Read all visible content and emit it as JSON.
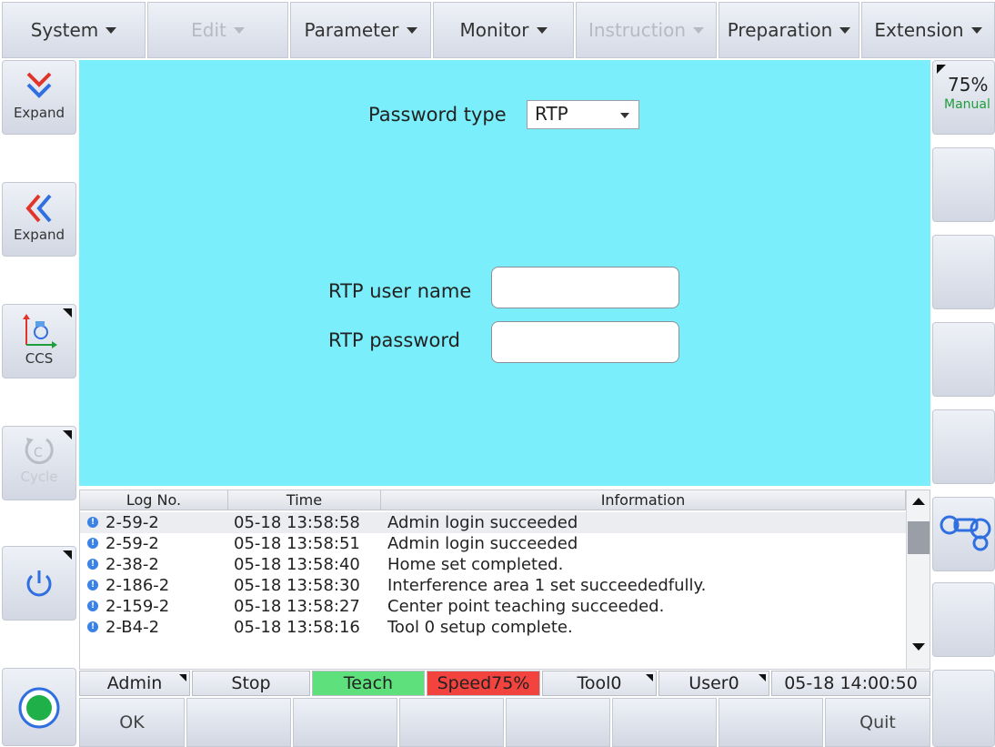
{
  "menu": [
    {
      "label": "System",
      "enabled": true
    },
    {
      "label": "Edit",
      "enabled": false
    },
    {
      "label": "Parameter",
      "enabled": true
    },
    {
      "label": "Monitor",
      "enabled": true
    },
    {
      "label": "Instruction",
      "enabled": false
    },
    {
      "label": "Preparation",
      "enabled": true
    },
    {
      "label": "Extension",
      "enabled": true
    }
  ],
  "left_buttons": {
    "expand_down": "Expand",
    "expand_left": "Expand",
    "ccs": "CCS",
    "cycle": "Cycle"
  },
  "speed_panel": {
    "speed": "75%",
    "mode": "Manual"
  },
  "form": {
    "password_type_label": "Password type",
    "password_type_value": "RTP",
    "user_label": "RTP user name",
    "user_value": "",
    "password_label": "RTP password",
    "password_value": ""
  },
  "log": {
    "headers": [
      "Log No.",
      "Time",
      "Information"
    ],
    "rows": [
      {
        "no": "2-59-2",
        "time": "05-18 13:58:58",
        "info": "Admin  login succeeded"
      },
      {
        "no": "2-59-2",
        "time": "05-18 13:58:51",
        "info": "Admin  login succeeded"
      },
      {
        "no": "2-38-2",
        "time": "05-18 13:58:40",
        "info": "Home set completed."
      },
      {
        "no": "2-186-2",
        "time": "05-18 13:58:30",
        "info": "Interference area 1 set succeededfully."
      },
      {
        "no": "2-159-2",
        "time": "05-18 13:58:27",
        "info": "Center point teaching succeeded."
      },
      {
        "no": "2-B4-2",
        "time": "05-18 13:58:16",
        "info": "Tool 0 setup complete."
      }
    ]
  },
  "status_bar": {
    "user": "Admin",
    "run_state": "Stop",
    "mode": "Teach",
    "speed": "Speed75%",
    "tool": "Tool0",
    "coord": "User0",
    "datetime": "05-18 14:00:50"
  },
  "bottom_buttons": {
    "ok": "OK",
    "quit": "Quit"
  },
  "colors": {
    "panel_bg": "#7beefb",
    "teach": "#5ee07c",
    "speed": "#f2433f",
    "accent_red": "#e0352b",
    "accent_blue": "#2f6fe0"
  }
}
